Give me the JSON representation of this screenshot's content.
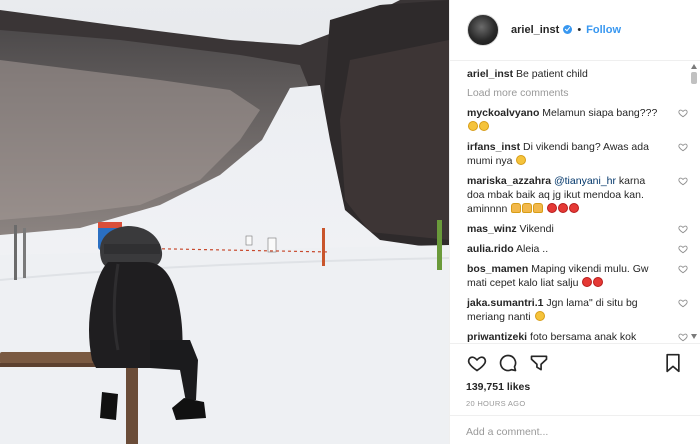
{
  "header": {
    "username": "ariel_inst",
    "separator": "•",
    "follow_label": "Follow"
  },
  "caption": {
    "username": "ariel_inst",
    "text": "Be patient child"
  },
  "load_more_label": "Load more comments",
  "comments": [
    {
      "username": "myckoalvyano",
      "text": "Melamun siapa bang???",
      "emoji": [
        "laughing-face-emoji",
        "laughing-face-emoji"
      ]
    },
    {
      "username": "irfans_inst",
      "text": "Di vikendi bang? Awas ada mumi nya",
      "emoji": [
        "laughing-face-emoji"
      ]
    },
    {
      "username": "mariska_azzahra",
      "mention": "@tianyani_hr",
      "text": " karna doa mbak baik aq jg ikut mendoa kan. aminnnn",
      "emoji": [
        "pray-emoji",
        "pray-emoji",
        "pray-emoji",
        "red-heart-emoji",
        "red-heart-emoji",
        "red-heart-emoji"
      ]
    },
    {
      "username": "mas_winz",
      "text": "Vikendi",
      "emoji": []
    },
    {
      "username": "aulia.rido",
      "text": "Aleia ..",
      "emoji": []
    },
    {
      "username": "bos_mamen",
      "text": "Maping vikendi mulu. Gw mati cepet kalo liat salju",
      "emoji": [
        "angry-face-emoji",
        "angry-face-emoji"
      ]
    },
    {
      "username": "jaka.sumantri.1",
      "text": "Jgn lama\" di situ bg meriang nanti",
      "emoji": [
        "laughing-face-emoji"
      ]
    },
    {
      "username": "priwantizeki",
      "text": "foto bersama anak kok pernah ada di IG",
      "emoji": []
    }
  ],
  "likes": "139,751 likes",
  "timestamp": "20 HOURS AGO",
  "add_comment_placeholder": "Add a comment...",
  "icons": {
    "like": "heart-icon",
    "comment": "comment-icon",
    "share": "share-icon",
    "save": "bookmark-icon",
    "verified": "verified-badge-icon"
  },
  "colors": {
    "accent": "#3897f0",
    "secondary_text": "#999999",
    "border": "#efefef"
  }
}
